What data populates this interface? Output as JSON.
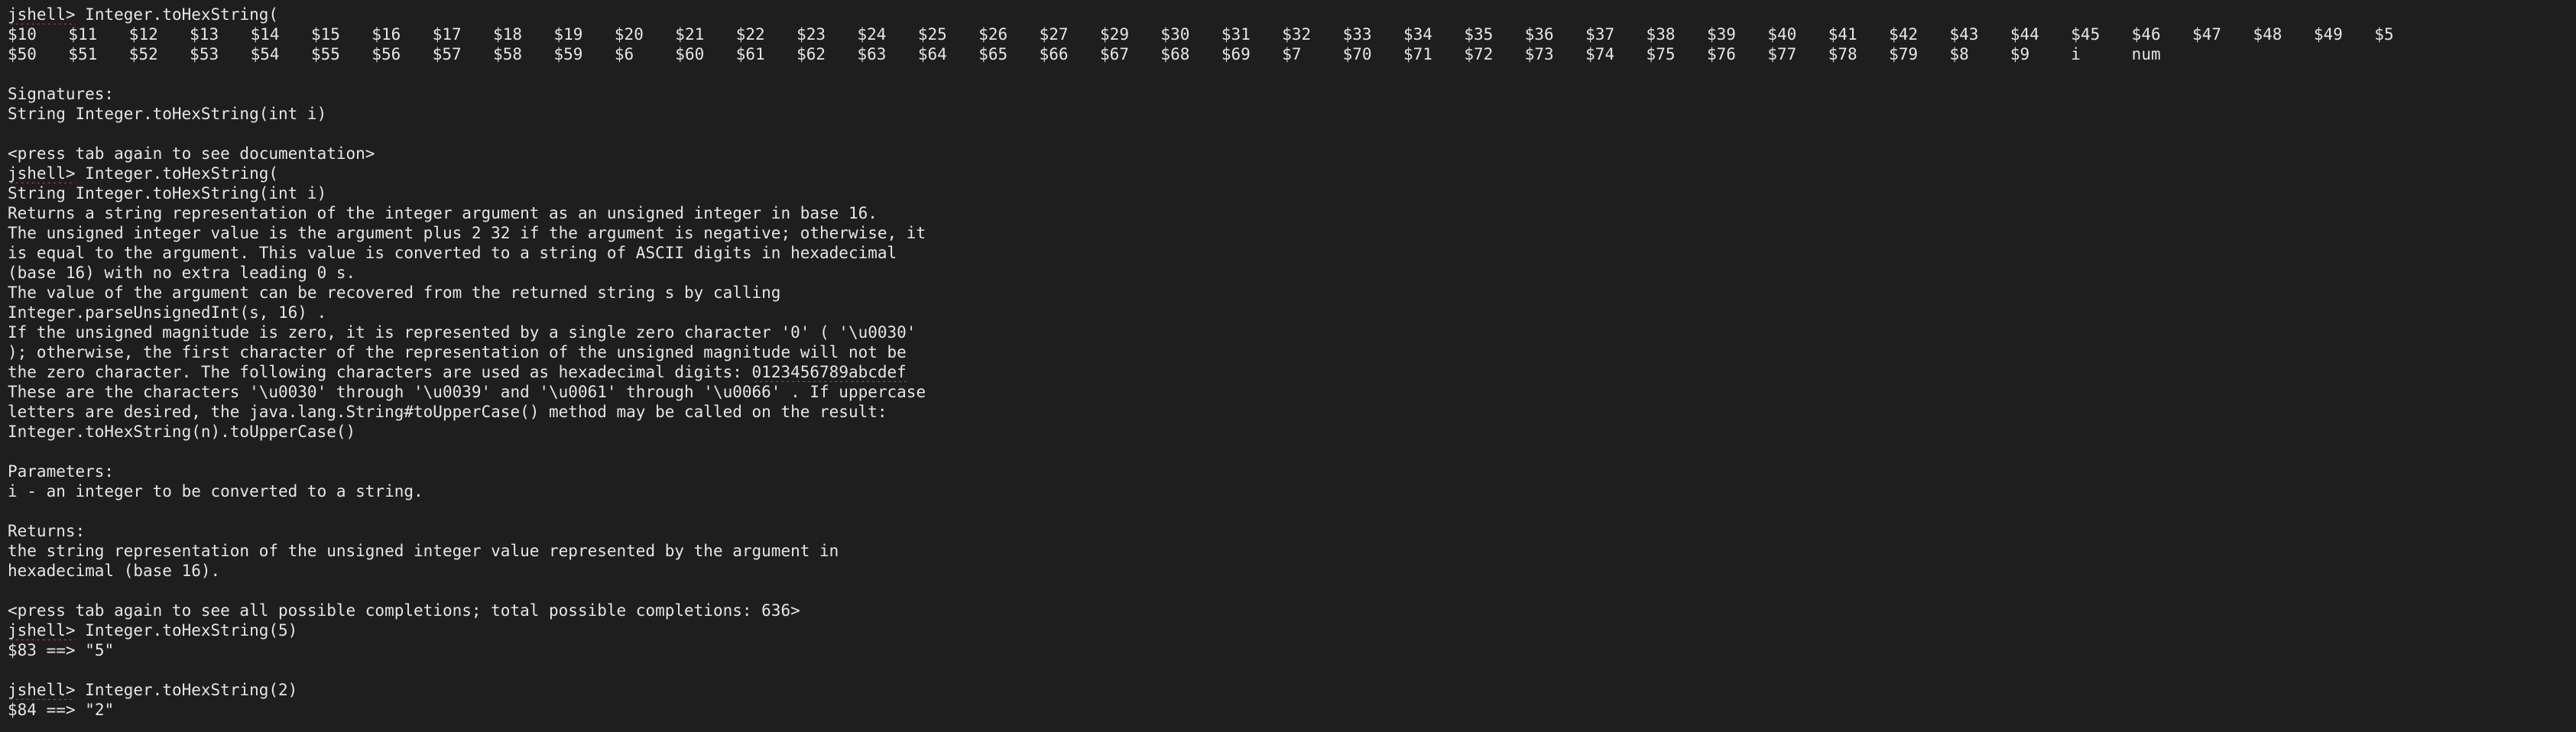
{
  "session": {
    "prompt": "jshell>",
    "commands": [
      "Integer.toHexString(",
      "Integer.toHexString(",
      "Integer.toHexString(5)",
      "Integer.toHexString(2)"
    ]
  },
  "completions": {
    "row1": [
      "$10",
      "$11",
      "$12",
      "$13",
      "$14",
      "$15",
      "$16",
      "$17",
      "$18",
      "$19",
      "$20",
      "$21",
      "$22",
      "$23",
      "$24",
      "$25",
      "$26",
      "$27",
      "$29",
      "$30",
      "$31",
      "$32",
      "$33",
      "$34",
      "$35",
      "$36",
      "$37",
      "$38",
      "$39",
      "$40",
      "$41",
      "$42",
      "$43",
      "$44",
      "$45",
      "$46",
      "$47",
      "$48",
      "$49",
      "$5"
    ],
    "row2": [
      "$50",
      "$51",
      "$52",
      "$53",
      "$54",
      "$55",
      "$56",
      "$57",
      "$58",
      "$59",
      "$6",
      "$60",
      "$61",
      "$62",
      "$63",
      "$64",
      "$65",
      "$66",
      "$67",
      "$68",
      "$69",
      "$7",
      "$70",
      "$71",
      "$72",
      "$73",
      "$74",
      "$75",
      "$76",
      "$77",
      "$78",
      "$79",
      "$8",
      "$9",
      "i",
      "num"
    ]
  },
  "signatures": {
    "heading": "Signatures:",
    "signature": "String Integer.toHexString(int i)",
    "hint": "<press tab again to see documentation>"
  },
  "documentation": {
    "signature": "String Integer.toHexString(int i)",
    "body_lines": [
      "Returns a string representation of the integer argument as an unsigned integer in base 16.",
      "The unsigned integer value is the argument plus 2 32 if the argument is negative; otherwise, it",
      "is equal to the argument. This value is converted to a string of ASCII digits in hexadecimal",
      "(base 16) with no extra leading 0 s.",
      "The value of the argument can be recovered from the returned string s by calling",
      "Integer.parseUnsignedInt(s, 16) .",
      "If the unsigned magnitude is zero, it is represented by a single zero character '0' ( '\\u0030'",
      "); otherwise, the first character of the representation of the unsigned magnitude will not be"
    ],
    "digits_line_prefix": "the zero character. The following characters are used as hexadecimal digits: ",
    "digits_word": "0123456789abcdef",
    "body_lines_2": [
      "These are the characters '\\u0030' through '\\u0039' and '\\u0061' through '\\u0066' . If uppercase",
      "letters are desired, the java.lang.String#toUpperCase() method may be called on the result:",
      "Integer.toHexString(n).toUpperCase()"
    ],
    "params_heading": "Parameters:",
    "param": "i - an integer to be converted to a string.",
    "returns_heading": "Returns:",
    "returns_lines": [
      "the string representation of the unsigned integer value represented by the argument in",
      "hexadecimal (base 16)."
    ],
    "hint": "<press tab again to see all possible completions; total possible completions: 636>"
  },
  "results": [
    {
      "var": "$83",
      "arrow": "==>",
      "value": "\"5\""
    },
    {
      "var": "$84",
      "arrow": "==>",
      "value": "\"2\""
    }
  ]
}
